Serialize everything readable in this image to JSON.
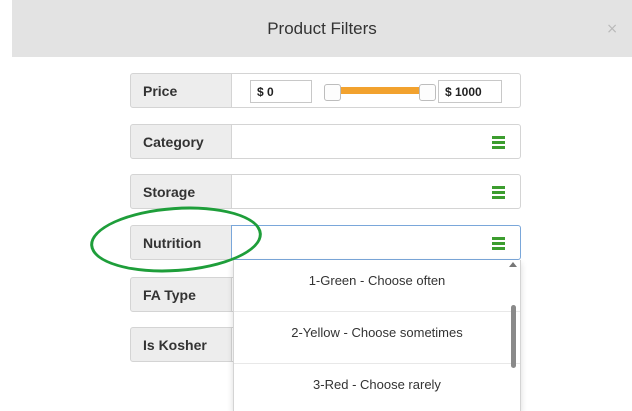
{
  "header": {
    "title": "Product Filters",
    "close_label": "×"
  },
  "filters": {
    "price": {
      "label": "Price",
      "min_value": "$ 0",
      "max_value": "$ 1000"
    },
    "category": {
      "label": "Category"
    },
    "storage": {
      "label": "Storage"
    },
    "nutrition": {
      "label": "Nutrition"
    },
    "fa_type": {
      "label": "FA Type"
    },
    "is_kosher": {
      "label": "Is Kosher"
    }
  },
  "nutrition_dropdown": {
    "options": [
      "1-Green - Choose often",
      "2-Yellow - Choose sometimes",
      "3-Red - Choose rarely"
    ]
  },
  "icons": {
    "menu_icon": "hamburger-menu-icon",
    "close_icon": "close-icon"
  },
  "colors": {
    "accent_green": "#3c9d2e",
    "slider_orange": "#f2a22e",
    "annotation_green": "#1e9e3a",
    "header_bg": "#e3e3e3"
  }
}
